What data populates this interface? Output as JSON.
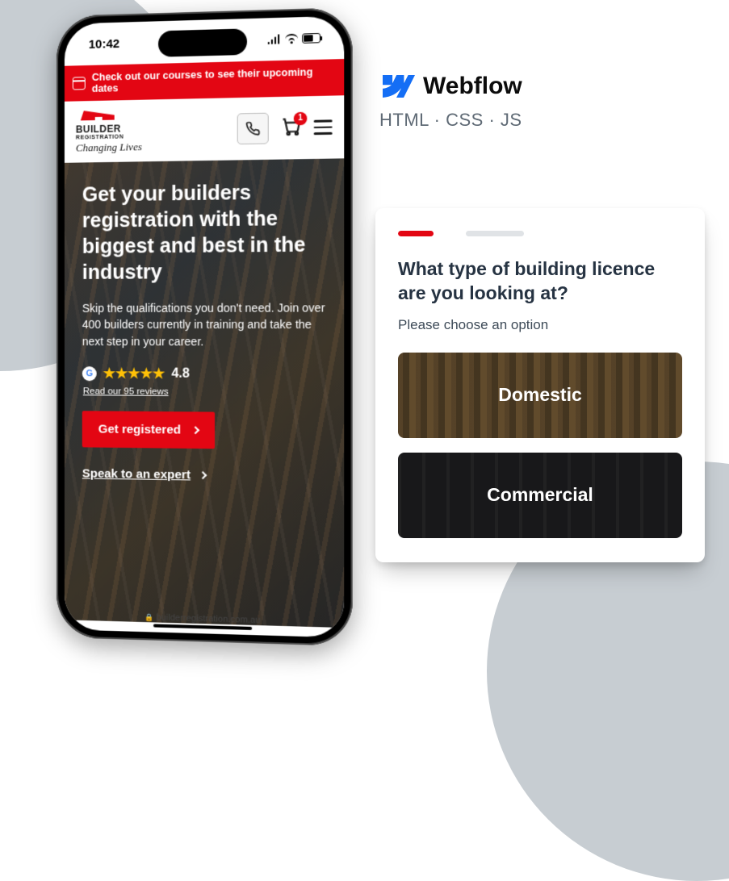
{
  "phone": {
    "time": "10:42",
    "banner": "Check out our courses to see their upcoming dates",
    "logo": {
      "line1": "BUILDER",
      "line2": "REGISTRATION",
      "tagline": "Changing Lives"
    },
    "cart_count": "1",
    "hero": {
      "headline": "Get your builders registration with the biggest and best in the industry",
      "subhead": "Skip the qualifications you don't need. Join over 400 builders currently in training and take the next step in your career.",
      "rating": "4.8",
      "reviews_link": "Read our 95 reviews",
      "cta": "Get registered",
      "expert_link": "Speak to an expert"
    },
    "url": "builderregistration.com.au"
  },
  "tech": {
    "webflow": "Webflow",
    "stack": "HTML · CSS · JS"
  },
  "form": {
    "question": "What type of building licence are you looking at?",
    "hint": "Please choose an option",
    "options": {
      "domestic": "Domestic",
      "commercial": "Commercial"
    }
  }
}
